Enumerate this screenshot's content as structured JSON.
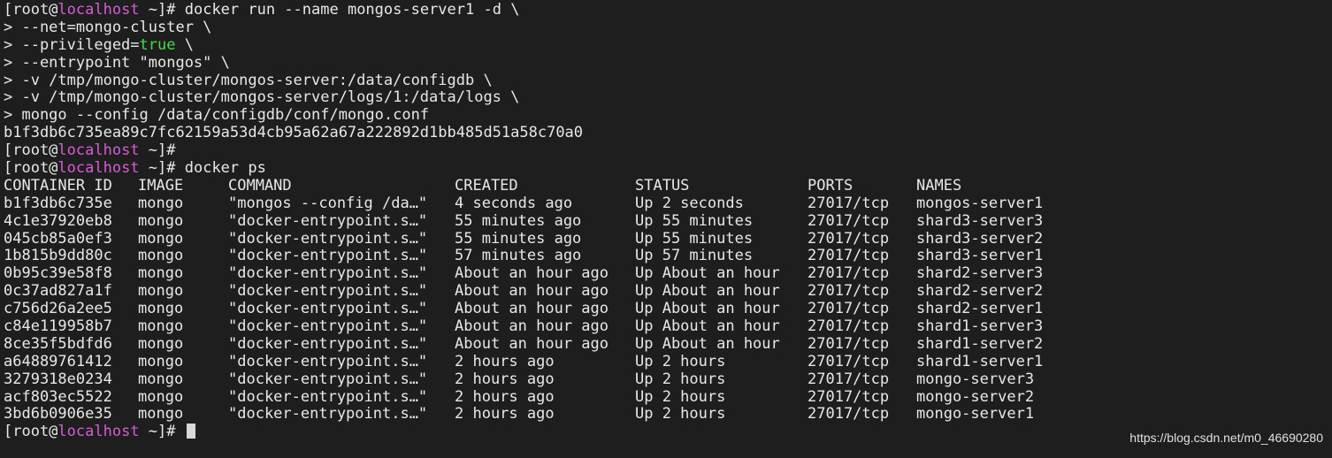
{
  "prompt": {
    "open": "[root@",
    "host": "localhost",
    "close": " ~]# "
  },
  "run_command": {
    "first": "docker run --name mongos-server1 -d \\",
    "continuations": [
      {
        "pre": "> --net=mongo-cluster \\",
        "green": "",
        "post": ""
      },
      {
        "pre": "> --privileged=",
        "green": "true",
        "post": " \\"
      },
      {
        "pre": "> --entrypoint \"mongos\" \\",
        "green": "",
        "post": ""
      },
      {
        "pre": "> -v /tmp/mongo-cluster/mongos-server:/data/configdb \\",
        "green": "",
        "post": ""
      },
      {
        "pre": "> -v /tmp/mongo-cluster/mongos-server/logs/1:/data/logs \\",
        "green": "",
        "post": ""
      },
      {
        "pre": "> mongo --config /data/configdb/conf/mongo.conf",
        "green": "",
        "post": ""
      }
    ],
    "output": "b1f3db6c735ea89c7fc62159a53d4cb95a62a67a222892d1bb485d51a58c70a0"
  },
  "ps_command": "docker ps",
  "table": {
    "headers": [
      "CONTAINER ID",
      "IMAGE",
      "COMMAND",
      "CREATED",
      "STATUS",
      "PORTS",
      "NAMES"
    ],
    "rows": [
      [
        "b1f3db6c735e",
        "mongo",
        "\"mongos --config /da…\"",
        "4 seconds ago",
        "Up 2 seconds",
        "27017/tcp",
        "mongos-server1"
      ],
      [
        "4c1e37920eb8",
        "mongo",
        "\"docker-entrypoint.s…\"",
        "55 minutes ago",
        "Up 55 minutes",
        "27017/tcp",
        "shard3-server3"
      ],
      [
        "045cb85a0ef3",
        "mongo",
        "\"docker-entrypoint.s…\"",
        "55 minutes ago",
        "Up 55 minutes",
        "27017/tcp",
        "shard3-server2"
      ],
      [
        "1b815b9dd80c",
        "mongo",
        "\"docker-entrypoint.s…\"",
        "57 minutes ago",
        "Up 57 minutes",
        "27017/tcp",
        "shard3-server1"
      ],
      [
        "0b95c39e58f8",
        "mongo",
        "\"docker-entrypoint.s…\"",
        "About an hour ago",
        "Up About an hour",
        "27017/tcp",
        "shard2-server3"
      ],
      [
        "0c37ad827a1f",
        "mongo",
        "\"docker-entrypoint.s…\"",
        "About an hour ago",
        "Up About an hour",
        "27017/tcp",
        "shard2-server2"
      ],
      [
        "c756d26a2ee5",
        "mongo",
        "\"docker-entrypoint.s…\"",
        "About an hour ago",
        "Up About an hour",
        "27017/tcp",
        "shard2-server1"
      ],
      [
        "c84e119958b7",
        "mongo",
        "\"docker-entrypoint.s…\"",
        "About an hour ago",
        "Up About an hour",
        "27017/tcp",
        "shard1-server3"
      ],
      [
        "8ce35f5bdfd6",
        "mongo",
        "\"docker-entrypoint.s…\"",
        "About an hour ago",
        "Up About an hour",
        "27017/tcp",
        "shard1-server2"
      ],
      [
        "a64889761412",
        "mongo",
        "\"docker-entrypoint.s…\"",
        "2 hours ago",
        "Up 2 hours",
        "27017/tcp",
        "shard1-server1"
      ],
      [
        "3279318e0234",
        "mongo",
        "\"docker-entrypoint.s…\"",
        "2 hours ago",
        "Up 2 hours",
        "27017/tcp",
        "mongo-server3"
      ],
      [
        "acf803ec5522",
        "mongo",
        "\"docker-entrypoint.s…\"",
        "2 hours ago",
        "Up 2 hours",
        "27017/tcp",
        "mongo-server2"
      ],
      [
        "3bd6b0906e35",
        "mongo",
        "\"docker-entrypoint.s…\"",
        "2 hours ago",
        "Up 2 hours",
        "27017/tcp",
        "mongo-server1"
      ]
    ]
  },
  "watermark": "https://blog.csdn.net/m0_46690280",
  "colors": {
    "background": "#1e1e1e",
    "text": "#e8e8e8",
    "hostname": "#d65bd6",
    "boolean": "#47d947"
  }
}
